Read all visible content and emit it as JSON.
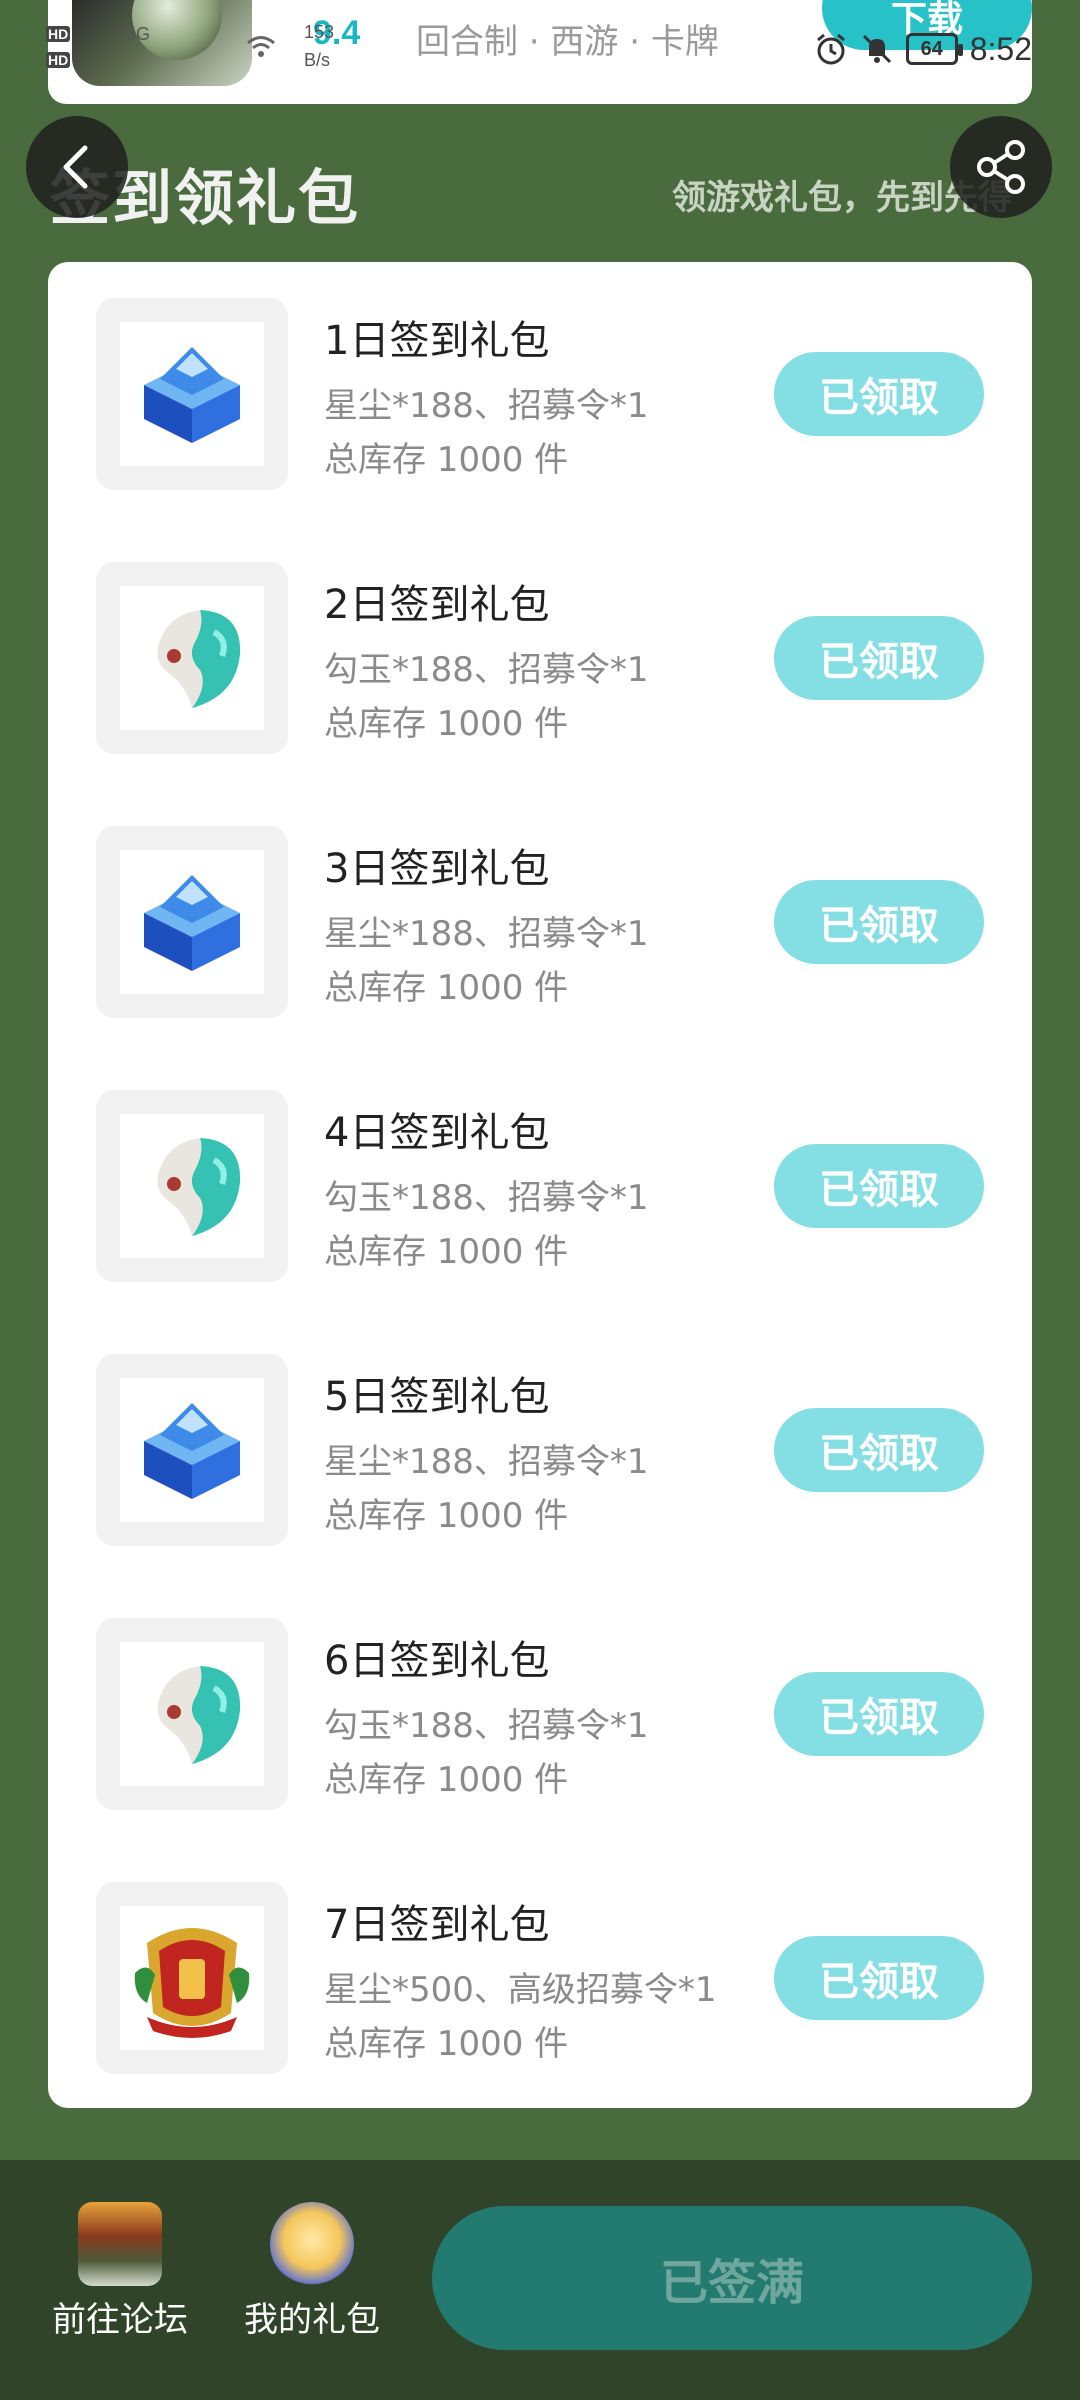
{
  "status_bar": {
    "network_left": "HD",
    "network_right": "HD",
    "signal_text": "5G",
    "net_speed": "153",
    "net_speed_unit": "B/s",
    "battery": "64",
    "time": "8:52"
  },
  "top_card": {
    "score": "9.4",
    "tags": "回合制 · 西游 · 卡牌",
    "download_label": "下载"
  },
  "section": {
    "title": "签到领礼包",
    "subtitle": "领游戏礼包，先到先得"
  },
  "gifts": [
    {
      "name": "1日签到礼包",
      "desc": "星尘*188、招募令*1",
      "stock": "总库存 1000 件",
      "button": "已领取",
      "icon": "blue-chest-icon"
    },
    {
      "name": "2日签到礼包",
      "desc": "勾玉*188、招募令*1",
      "stock": "总库存 1000 件",
      "button": "已领取",
      "icon": "magatama-icon"
    },
    {
      "name": "3日签到礼包",
      "desc": "星尘*188、招募令*1",
      "stock": "总库存 1000 件",
      "button": "已领取",
      "icon": "blue-chest-icon"
    },
    {
      "name": "4日签到礼包",
      "desc": "勾玉*188、招募令*1",
      "stock": "总库存 1000 件",
      "button": "已领取",
      "icon": "magatama-icon"
    },
    {
      "name": "5日签到礼包",
      "desc": "星尘*188、招募令*1",
      "stock": "总库存 1000 件",
      "button": "已领取",
      "icon": "blue-chest-icon"
    },
    {
      "name": "6日签到礼包",
      "desc": "勾玉*188、招募令*1",
      "stock": "总库存 1000 件",
      "button": "已领取",
      "icon": "magatama-icon"
    },
    {
      "name": "7日签到礼包",
      "desc": "星尘*500、高级招募令*1",
      "stock": "总库存 1000 件",
      "button": "已领取",
      "icon": "recruit-token-icon"
    }
  ],
  "bottom_bar": {
    "forum_label": "前往论坛",
    "my_gifts_label": "我的礼包",
    "signed_label": "已签满"
  },
  "colors": {
    "background": "#4a6b3e",
    "claimed_button": "#84dfe5",
    "signed_button": "#237a70",
    "accent": "#27c2c7"
  }
}
